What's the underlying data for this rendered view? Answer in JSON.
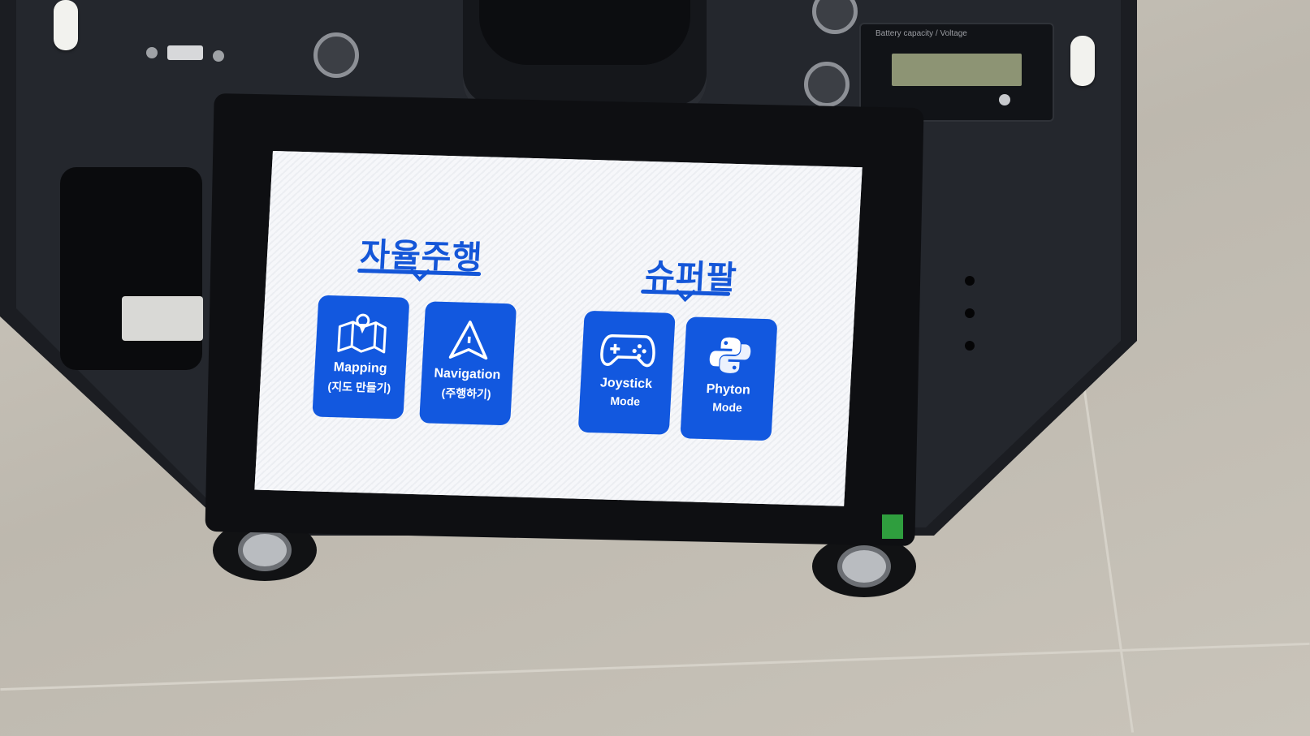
{
  "battery": {
    "label": "Battery capacity / Voltage"
  },
  "screen": {
    "section_left": {
      "title": "자율주행"
    },
    "section_right": {
      "title": "슈퍼팔"
    },
    "tiles": [
      {
        "line1": "Mapping",
        "line2": "(지도 만들기)",
        "icon": "map-pin-icon"
      },
      {
        "line1": "Navigation",
        "line2": "(주행하기)",
        "icon": "navigation-arrow-icon"
      },
      {
        "line1": "Joystick",
        "line2": "Mode",
        "icon": "gamepad-icon"
      },
      {
        "line1": "Phyton",
        "line2": "Mode",
        "icon": "python-icon"
      }
    ]
  },
  "colors": {
    "accent": "#1258df",
    "screen_bg": "#f4f6fa",
    "robot_body": "#1b1d22"
  }
}
